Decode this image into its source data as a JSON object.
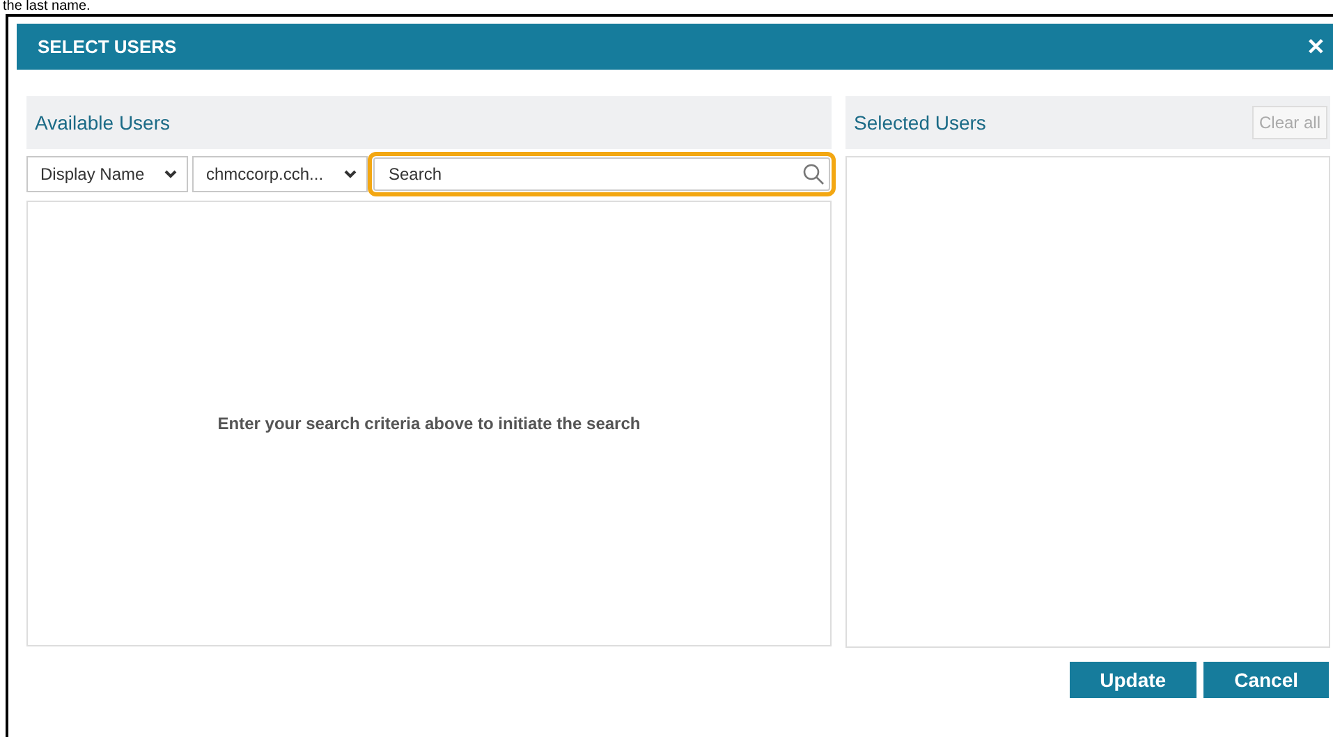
{
  "caption": "the last name.",
  "dialog": {
    "title": "SELECT USERS",
    "close": "✕"
  },
  "available": {
    "title": "Available Users",
    "filters": [
      {
        "value": "Display Name"
      },
      {
        "value": "chmccorp.cch..."
      }
    ],
    "search": {
      "placeholder": "Search",
      "focused": true
    },
    "empty_message": "Enter your search criteria above to initiate the search"
  },
  "selected": {
    "title": "Selected Users",
    "clear": "Clear all"
  },
  "buttons": [
    "Update",
    "Cancel"
  ]
}
